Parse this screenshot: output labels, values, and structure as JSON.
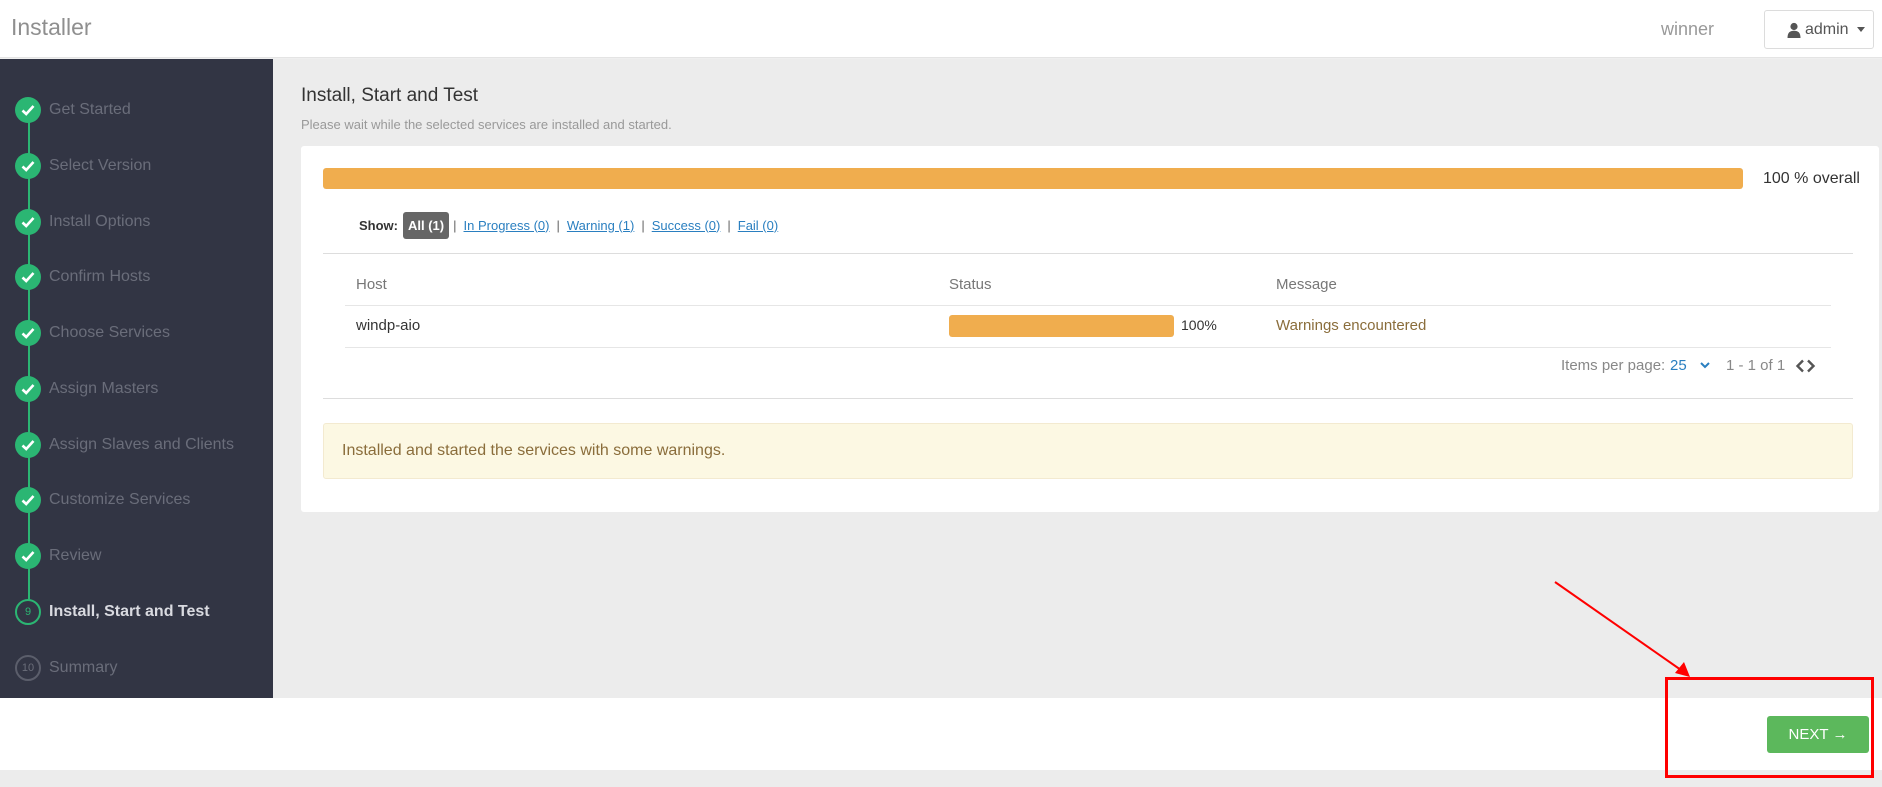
{
  "header": {
    "app_title": "Installer",
    "cluster_name": "winner",
    "user_label": "admin"
  },
  "sidebar": {
    "steps": [
      {
        "label": "Get Started",
        "state": "done"
      },
      {
        "label": "Select Version",
        "state": "done"
      },
      {
        "label": "Install Options",
        "state": "done"
      },
      {
        "label": "Confirm Hosts",
        "state": "done"
      },
      {
        "label": "Choose Services",
        "state": "done"
      },
      {
        "label": "Assign Masters",
        "state": "done"
      },
      {
        "label": "Assign Slaves and Clients",
        "state": "done"
      },
      {
        "label": "Customize Services",
        "state": "done"
      },
      {
        "label": "Review",
        "state": "done"
      },
      {
        "label": "Install, Start and Test",
        "state": "active",
        "number": "9"
      },
      {
        "label": "Summary",
        "state": "todo",
        "number": "10"
      }
    ]
  },
  "main": {
    "title": "Install, Start and Test",
    "subtitle": "Please wait while the selected services are installed and started.",
    "overall_progress": 100,
    "overall_text": "100 % overall",
    "filters": {
      "show_label": "Show:",
      "all": "All (1)",
      "in_progress": "In Progress (0)",
      "warning": "Warning (1)",
      "success": "Success (0)",
      "fail": "Fail (0)"
    },
    "table": {
      "columns": [
        "Host",
        "Status",
        "Message"
      ],
      "rows": [
        {
          "host": "windp-aio",
          "progress": 100,
          "progress_text": "100%",
          "message": "Warnings encountered"
        }
      ]
    },
    "pager": {
      "items_per_page_label": "Items per page:",
      "items_per_page": "25",
      "range": "1 - 1 of 1"
    },
    "alert": "Installed and started the services with some warnings."
  },
  "footer": {
    "next_label": "NEXT →"
  },
  "colors": {
    "sidebar_bg": "#323544",
    "step_done": "#2bb673",
    "progress": "#f0ad4e",
    "next_button": "#5cb85c",
    "annotation": "#ff0000"
  }
}
